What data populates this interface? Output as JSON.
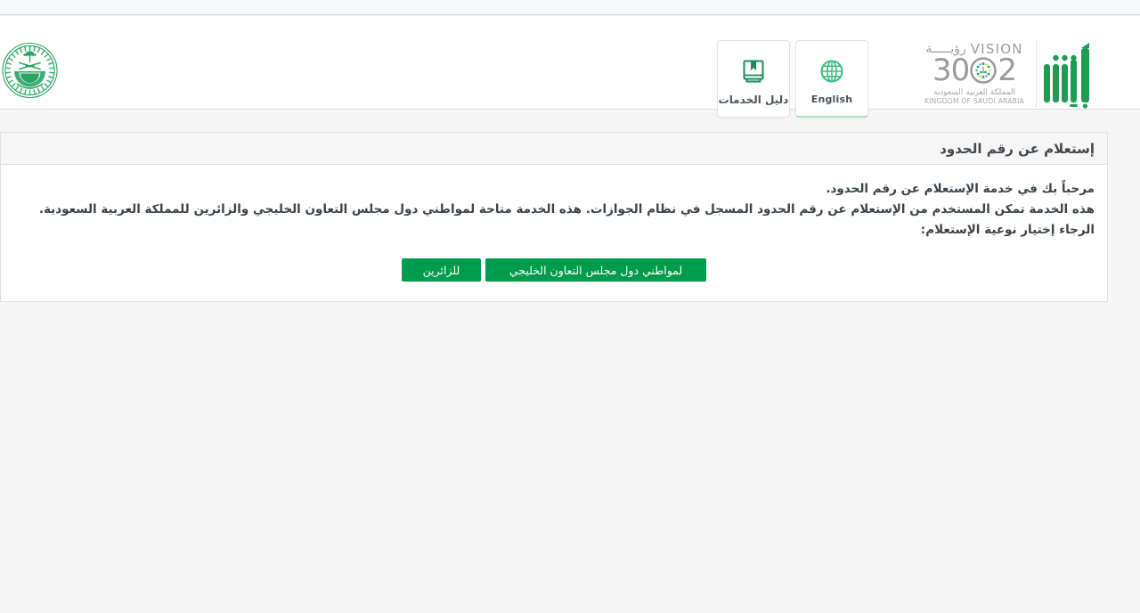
{
  "header": {
    "emblem": {
      "name": "ministry-of-interior-emblem",
      "alt": "وزارة الداخلية",
      "color": "#2aa563"
    },
    "tools": [
      {
        "id": "language-switch",
        "label": "English",
        "icon": "globe-icon",
        "icon_color": "#3cbd7c",
        "accent": "#a8e6c4",
        "lang": "en"
      },
      {
        "id": "services-guide",
        "label": "دليل الخدمات",
        "icon": "book-guide-icon",
        "icon_color": "#1d8a5e",
        "accent": "",
        "lang": "ar"
      }
    ],
    "vision": {
      "word_en": "VISION",
      "word_ar": "رؤيـــــة",
      "year_left": "2",
      "year_right": "30",
      "subtitle_ar": "المملكة العربية السعودية",
      "subtitle_en": "KINGDOM OF SAUDI ARABIA",
      "color": "#9a9b9e"
    },
    "absher": {
      "name": "absher-logo",
      "alt": "أبشر",
      "color": "#1f9c50"
    }
  },
  "card": {
    "title": "إستعلام عن رقم الحدود",
    "lines": [
      "مرحباً بك في خدمة الإستعلام عن رقم الحدود.",
      "هذه الخدمة تمكن المستخدم من الإستعلام عن رقم الحدود المسجل في نظام الجوازات. هذه الخدمة متاحة لمواطني دول مجلس التعاون الخليجي والزائرين للمملكة العربية السعودية.",
      "الرجاء إختيار نوعية الإستعلام:"
    ],
    "buttons": [
      {
        "id": "gcc-citizens",
        "label": "لمواطني دول مجلس التعاون الخليجي"
      },
      {
        "id": "visitors",
        "label": "للزائرين"
      }
    ],
    "button_color": "#009b4d"
  }
}
